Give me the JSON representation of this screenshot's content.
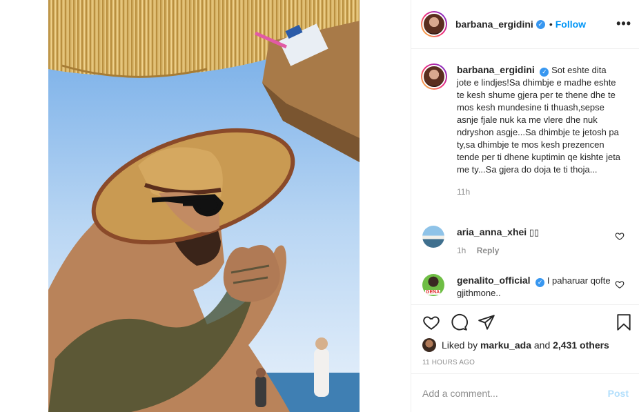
{
  "post": {
    "author": "barbana_ergidini",
    "follow_label": "Follow",
    "dot": "•",
    "more_label": "•••"
  },
  "caption": {
    "username": "barbana_ergidini",
    "text": "Sot eshte dita jote e lindjes!Sa dhimbje e madhe eshte te kesh shume gjera per te thene dhe te mos kesh mundesine ti thuash,sepse asnje fjale nuk ka me vlere dhe nuk ndryshon asgje...Sa dhimbje te jetosh pa ty,sa dhimbje te mos kesh prezencen tende per ti dhene kuptimin qe kishte jeta me ty...Sa gjera do doja te ti thoja...",
    "time": "11h"
  },
  "comments": [
    {
      "username": "aria_anna_xhei",
      "text": "▯▯",
      "time": "1h",
      "reply_label": "Reply"
    },
    {
      "username": "genalito_official",
      "text": "I paharuar qofte gjithmone..",
      "avatar_text": "GENA"
    }
  ],
  "likes": {
    "prefix": "Liked by ",
    "user": "marku_ada",
    "middle": " and ",
    "count": "2,431 others"
  },
  "timestamp": "11 HOURS AGO",
  "add_comment": {
    "placeholder": "Add a comment...",
    "post_label": "Post"
  },
  "colors": {
    "accent": "#0095f6",
    "verified": "#3897f0",
    "muted": "#8e8e8e",
    "post_disabled": "#b2dffc"
  },
  "icons": [
    "verified-badge-icon",
    "more-options-icon",
    "heart-icon",
    "comment-icon",
    "share-icon",
    "bookmark-icon"
  ]
}
